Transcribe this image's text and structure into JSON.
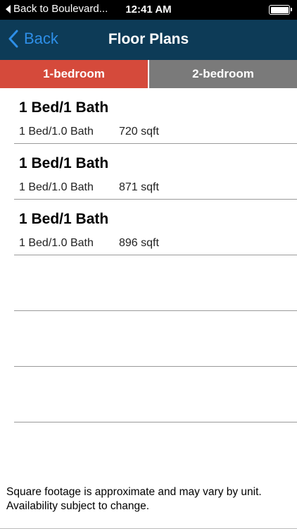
{
  "status_bar": {
    "back_label": "Back to Boulevard...",
    "time": "12:41 AM"
  },
  "nav": {
    "back_label": "Back",
    "title": "Floor Plans",
    "accent_color": "#2e8fe8",
    "bar_color": "#0d3b57"
  },
  "tabs": [
    {
      "label": "1-bedroom",
      "active": true,
      "color": "#d54a3b"
    },
    {
      "label": "2-bedroom",
      "active": false,
      "color": "#7a7a7a"
    }
  ],
  "floor_plans": [
    {
      "title": "1 Bed/1 Bath",
      "beds_baths": "1 Bed/1.0 Bath",
      "sqft": "720 sqft"
    },
    {
      "title": "1 Bed/1 Bath",
      "beds_baths": "1 Bed/1.0 Bath",
      "sqft": "871 sqft"
    },
    {
      "title": "1 Bed/1 Bath",
      "beds_baths": "1 Bed/1.0 Bath",
      "sqft": "896 sqft"
    }
  ],
  "disclaimer": {
    "line1": "Square footage is approximate and may vary by unit.",
    "line2": "Availability subject to change."
  }
}
